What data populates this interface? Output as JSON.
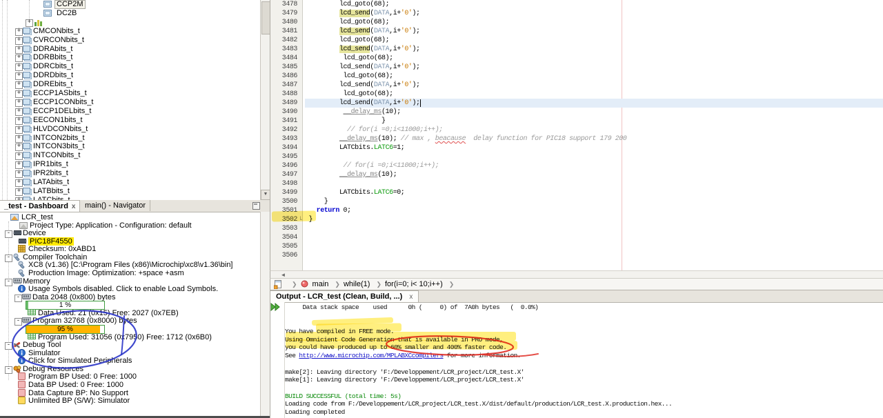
{
  "colors": {
    "marker_yellow": "rgba(255,224,0,0.5)",
    "pen_blue": "#2b35c8",
    "pen_red": "#e03028",
    "bar_green_border": "#3f9c3f",
    "bar_orange_fill": "#ffb400",
    "bar_green_fill": "#6fbf6f",
    "token_occurrence": "#e6e59c",
    "highlight_device": "#ffe900"
  },
  "tree": {
    "rows": [
      {
        "label": "CCP2M",
        "icon": "member",
        "level": 3,
        "selected": true
      },
      {
        "label": "DC2B",
        "icon": "member",
        "level": 3
      },
      {
        "label": "",
        "icon": "bars",
        "exp": "+",
        "level": 2
      },
      {
        "label": "CMCONbits_t",
        "icon": "struct",
        "exp": "+",
        "level": 1
      },
      {
        "label": "CVRCONbits_t",
        "icon": "struct",
        "exp": "+",
        "level": 1
      },
      {
        "label": "DDRAbits_t",
        "icon": "struct",
        "exp": "+",
        "level": 1
      },
      {
        "label": "DDRBbits_t",
        "icon": "struct",
        "exp": "+",
        "level": 1
      },
      {
        "label": "DDRCbits_t",
        "icon": "struct",
        "exp": "+",
        "level": 1
      },
      {
        "label": "DDRDbits_t",
        "icon": "struct",
        "exp": "+",
        "level": 1
      },
      {
        "label": "DDREbits_t",
        "icon": "struct",
        "exp": "+",
        "level": 1
      },
      {
        "label": "ECCP1ASbits_t",
        "icon": "struct",
        "exp": "+",
        "level": 1
      },
      {
        "label": "ECCP1CONbits_t",
        "icon": "struct",
        "exp": "+",
        "level": 1
      },
      {
        "label": "ECCP1DELbits_t",
        "icon": "struct",
        "exp": "+",
        "level": 1
      },
      {
        "label": "EECON1bits_t",
        "icon": "struct",
        "exp": "+",
        "level": 1
      },
      {
        "label": "HLVDCONbits_t",
        "icon": "struct",
        "exp": "+",
        "level": 1
      },
      {
        "label": "INTCON2bits_t",
        "icon": "struct",
        "exp": "+",
        "level": 1
      },
      {
        "label": "INTCON3bits_t",
        "icon": "struct",
        "exp": "+",
        "level": 1
      },
      {
        "label": "INTCONbits_t",
        "icon": "struct",
        "exp": "+",
        "level": 1
      },
      {
        "label": "IPR1bits_t",
        "icon": "struct",
        "exp": "+",
        "level": 1
      },
      {
        "label": "IPR2bits_t",
        "icon": "struct",
        "exp": "+",
        "level": 1
      },
      {
        "label": "LATAbits_t",
        "icon": "struct",
        "exp": "+",
        "level": 1
      },
      {
        "label": "LATBbits_t",
        "icon": "struct",
        "exp": "+",
        "level": 1
      },
      {
        "label": "LATCbits_t",
        "icon": "struct",
        "exp": "+",
        "level": 1
      }
    ]
  },
  "dashboard": {
    "tabs": [
      {
        "label": "_test - Dashboard",
        "close": "x",
        "active": true
      },
      {
        "label": "main() - Navigator",
        "active": false
      }
    ],
    "rows": [
      {
        "label": "LCR_test",
        "icon": "project",
        "lvl": "root"
      },
      {
        "label": "Project Type: Application - Configuration: default",
        "icon": "project-gray",
        "lvl": "l1leaf"
      },
      {
        "label": "Device",
        "icon": "chip",
        "exp": "-",
        "lvl": "l1"
      },
      {
        "label": "PIC18F4550",
        "icon": "chip",
        "lvl": "l2leaf",
        "hl": true
      },
      {
        "label": "Checksum: 0xABD1",
        "icon": "checksum",
        "lvl": "l2leaf"
      },
      {
        "label": "Compiler Toolchain",
        "icon": "tool",
        "exp": "-",
        "lvl": "l1"
      },
      {
        "label": "XC8 (v1.36) [C:\\Program Files (x86)\\Microchip\\xc8\\v1.36\\bin]",
        "icon": "tool",
        "lvl": "l2leaf"
      },
      {
        "label": "Production Image: Optimization: +space +asm",
        "icon": "tool",
        "lvl": "l2leaf"
      },
      {
        "label": "Memory",
        "icon": "ram",
        "exp": "-",
        "lvl": "l1"
      },
      {
        "label": "Usage Symbols disabled. Click to enable Load Symbols.",
        "icon": "info",
        "lvl": "l2leaf"
      },
      {
        "label": "Data 2048 (0x800) bytes",
        "icon": "ram",
        "exp": "-",
        "lvl": "l2"
      },
      {
        "bar": {
          "label": "1 %",
          "pct": 3,
          "fill": "green"
        }
      },
      {
        "label": "Data Used: 21 (0x15) Free: 2027 (0x7EB)",
        "icon": "grid",
        "lvl": "l3leaf"
      },
      {
        "label": "Program 32768 (0x8000) bytes",
        "icon": "ram",
        "exp": "-",
        "lvl": "l2"
      },
      {
        "bar": {
          "label": "95 %",
          "pct": 95,
          "fill": "orange"
        }
      },
      {
        "label": "Program Used: 31056 (0x7950) Free: 1712 (0x6B0)",
        "icon": "grid",
        "lvl": "l3leaf"
      },
      {
        "label": "Debug Tool",
        "icon": "debugtool",
        "exp": "-",
        "lvl": "l1"
      },
      {
        "label": "Simulator",
        "icon": "info",
        "lvl": "l2leaf"
      },
      {
        "label": "Click for Simulated Peripherals",
        "icon": "info",
        "lvl": "l2leaf"
      },
      {
        "label": "Debug Resources",
        "icon": "debugres",
        "exp": "-",
        "lvl": "l1"
      },
      {
        "label": "Program BP Used: 0  Free: 1000",
        "icon": "bp-pink",
        "lvl": "l2leaf"
      },
      {
        "label": "Data BP Used: 0  Free: 1000",
        "icon": "bp-pink",
        "lvl": "l2leaf"
      },
      {
        "label": "Data Capture BP: No Support",
        "icon": "bp-pink",
        "lvl": "l2leaf"
      },
      {
        "label": "Unlimited BP (S/W): Simulator",
        "icon": "bp-yellow",
        "lvl": "l2leaf"
      }
    ]
  },
  "editor": {
    "lines": [
      {
        "n": 3478,
        "t": [
          [
            "p",
            "         lcd_goto(68);"
          ]
        ]
      },
      {
        "n": 3479,
        "t": [
          [
            "p",
            "         "
          ],
          [
            "hl",
            "lcd_send"
          ],
          [
            "p",
            "("
          ],
          [
            "m",
            "DATA"
          ],
          [
            "p",
            ",i+"
          ],
          [
            "ch",
            "'0'"
          ],
          [
            "p",
            ");"
          ]
        ]
      },
      {
        "n": 3480,
        "t": [
          [
            "p",
            "         lcd_goto(68);"
          ]
        ]
      },
      {
        "n": 3481,
        "t": [
          [
            "p",
            "         "
          ],
          [
            "hl",
            "lcd_send"
          ],
          [
            "p",
            "("
          ],
          [
            "m",
            "DATA"
          ],
          [
            "p",
            ",i+"
          ],
          [
            "ch",
            "'0'"
          ],
          [
            "p",
            ");"
          ]
        ]
      },
      {
        "n": 3482,
        "t": [
          [
            "p",
            "         lcd_goto(68);"
          ]
        ]
      },
      {
        "n": 3483,
        "t": [
          [
            "p",
            "         "
          ],
          [
            "hl",
            "lcd_send"
          ],
          [
            "p",
            "("
          ],
          [
            "m",
            "DATA"
          ],
          [
            "p",
            ",i+"
          ],
          [
            "ch",
            "'0'"
          ],
          [
            "p",
            ");"
          ]
        ]
      },
      {
        "n": 3484,
        "t": [
          [
            "p",
            "          lcd_goto(68);"
          ]
        ]
      },
      {
        "n": 3485,
        "t": [
          [
            "p",
            "         lcd_send("
          ],
          [
            "m",
            "DATA"
          ],
          [
            "p",
            ",i+"
          ],
          [
            "ch",
            "'0'"
          ],
          [
            "p",
            ");"
          ]
        ]
      },
      {
        "n": 3486,
        "t": [
          [
            "p",
            "          lcd_goto(68);"
          ]
        ]
      },
      {
        "n": 3487,
        "t": [
          [
            "p",
            "         lcd_send("
          ],
          [
            "m",
            "DATA"
          ],
          [
            "p",
            ",i+"
          ],
          [
            "ch",
            "'0'"
          ],
          [
            "p",
            ");"
          ]
        ]
      },
      {
        "n": 3488,
        "t": [
          [
            "p",
            "          lcd_goto(68);"
          ]
        ]
      },
      {
        "n": 3489,
        "cur": true,
        "t": [
          [
            "p",
            "         lcd_send("
          ],
          [
            "m",
            "DATA"
          ],
          [
            "p",
            ",i+"
          ],
          [
            "ch",
            "'0'"
          ],
          [
            "p",
            ");"
          ]
        ]
      },
      {
        "n": 3490,
        "t": [
          [
            "p",
            "          "
          ],
          [
            "gu",
            "__delay_ms"
          ],
          [
            "p",
            "(10);"
          ]
        ]
      },
      {
        "n": 3491,
        "t": [
          [
            "p",
            "                    }"
          ]
        ]
      },
      {
        "n": 3492,
        "t": [
          [
            "c",
            "           // for(i =0;i<11000;i++);"
          ]
        ]
      },
      {
        "n": 3493,
        "t": [
          [
            "p",
            "         "
          ],
          [
            "gu",
            "__delay_ms"
          ],
          [
            "p",
            "(10); "
          ],
          [
            "c",
            "// max , "
          ],
          [
            "cerr",
            "beacause"
          ],
          [
            "c",
            "  delay function for PIC18 support 179 200"
          ]
        ]
      },
      {
        "n": 3494,
        "t": [
          [
            "p",
            "         LATCbits."
          ],
          [
            "f",
            "LATC6"
          ],
          [
            "p",
            "=1;"
          ]
        ]
      },
      {
        "n": 3495,
        "t": []
      },
      {
        "n": 3496,
        "t": [
          [
            "c",
            "          // for(i =0;i<11000;i++);"
          ]
        ]
      },
      {
        "n": 3497,
        "t": [
          [
            "p",
            "         "
          ],
          [
            "gu",
            "__delay_ms"
          ],
          [
            "p",
            "(10);"
          ]
        ]
      },
      {
        "n": 3498,
        "t": []
      },
      {
        "n": 3499,
        "t": [
          [
            "p",
            "         LATCbits."
          ],
          [
            "f",
            "LATC6"
          ],
          [
            "p",
            "=0;"
          ]
        ]
      },
      {
        "n": 3500,
        "t": [
          [
            "p",
            "     }"
          ]
        ]
      },
      {
        "n": 3501,
        "t": [
          [
            "p",
            "   "
          ],
          [
            "kw",
            "return"
          ],
          [
            "p",
            " 0;"
          ]
        ]
      },
      {
        "n": 3502,
        "t": [
          [
            "p",
            " }"
          ]
        ]
      },
      {
        "n": 3503,
        "t": []
      },
      {
        "n": 3504,
        "t": []
      },
      {
        "n": 3505,
        "t": []
      },
      {
        "n": 3506,
        "t": []
      }
    ],
    "fold_end_glyph": "└",
    "hscroll_left_arrow": "◄"
  },
  "breadcrumb": {
    "items": [
      {
        "icon": "filehist",
        "label": ""
      },
      {
        "icon": "method",
        "label": "main"
      },
      {
        "label": "while(1)"
      },
      {
        "label": "for(i=0; i< 10;i++)"
      }
    ]
  },
  "output": {
    "tab": "Output - LCR_test (Clean, Build, ...)",
    "close": "x",
    "lines": [
      {
        "t": [
          [
            "p",
            "     Data stack space    used      0h (     0) of  7A0h bytes   (  0.0%)"
          ]
        ]
      },
      {
        "t": []
      },
      {
        "t": []
      },
      {
        "t": [
          [
            "p",
            "You have compiled in FREE mode."
          ]
        ]
      },
      {
        "t": [
          [
            "p",
            "Using Omnicient Code Generation that is available in PRO mode,"
          ]
        ]
      },
      {
        "t": [
          [
            "p",
            "you could have produced up to 60% smaller and 400% faster code."
          ]
        ]
      },
      {
        "t": [
          [
            "p",
            "See "
          ],
          [
            "link",
            "http://www.microchip.com/MPLABXCcompilers"
          ],
          [
            "p",
            " for more information."
          ]
        ]
      },
      {
        "t": []
      },
      {
        "t": [
          [
            "p",
            "make[2]: Leaving directory 'F:/Developpement/LCR_project/LCR_test.X'"
          ]
        ]
      },
      {
        "t": [
          [
            "p",
            "make[1]: Leaving directory 'F:/Developpement/LCR_project/LCR_test.X'"
          ]
        ]
      },
      {
        "t": []
      },
      {
        "t": [
          [
            "grn",
            "BUILD SUCCESSFUL (total time: 5s)"
          ]
        ]
      },
      {
        "t": [
          [
            "p",
            "Loading code from F:/Developpement/LCR_project/LCR_test.X/dist/default/production/LCR_test.X.production.hex..."
          ]
        ]
      },
      {
        "t": [
          [
            "p",
            "Loading completed"
          ]
        ]
      }
    ]
  }
}
